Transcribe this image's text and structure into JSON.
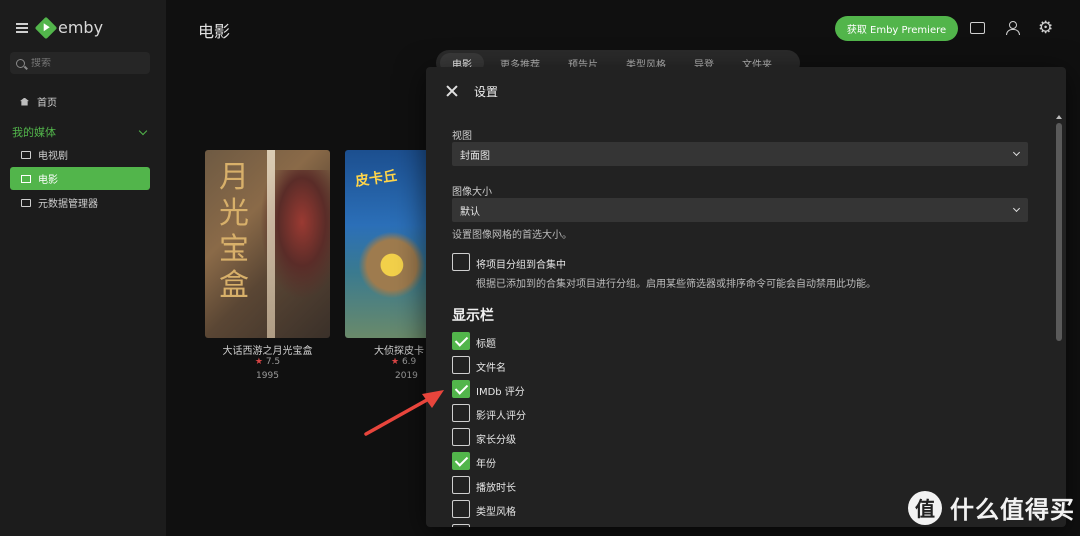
{
  "brand": {
    "name": "emby"
  },
  "sidebar": {
    "search_placeholder": "搜索",
    "home_label": "首页",
    "section_label": "我的媒体",
    "items": [
      {
        "label": "电视剧",
        "icon": "tv-icon",
        "active": false
      },
      {
        "label": "电影",
        "icon": "film-icon",
        "active": true
      },
      {
        "label": "元数据管理器",
        "icon": "folder-icon",
        "active": false
      }
    ]
  },
  "header": {
    "title": "电影",
    "premiere_label": "获取 Emby Premiere",
    "accent": "#52b54b"
  },
  "tabs": [
    "电影",
    "更多推荐",
    "预告片",
    "类型风格",
    "导登",
    "文件夹"
  ],
  "posters": [
    {
      "poster_text": "月光宝盒",
      "title": "大话西游之月光宝盒",
      "rating": "7.5",
      "year": "1995"
    },
    {
      "poster_text": "皮卡丘",
      "title": "大侦探皮卡",
      "rating": "6.9",
      "year": "2019"
    }
  ],
  "dialog": {
    "title": "设置",
    "view_label": "视图",
    "view_value": "封面图",
    "image_size_label": "图像大小",
    "image_size_value": "默认",
    "image_size_help": "设置图像网格的首选大小。",
    "group_label": "将项目分组到合集中",
    "group_desc": "根据已添加到的合集对项目进行分组。启用某些筛选器或排序命令可能会自动禁用此功能。",
    "group_checked": false,
    "columns_title": "显示栏",
    "columns": [
      {
        "label": "标题",
        "checked": true
      },
      {
        "label": "文件名",
        "checked": false
      },
      {
        "label": "IMDb 评分",
        "checked": true
      },
      {
        "label": "影评人评分",
        "checked": false
      },
      {
        "label": "家长分级",
        "checked": false
      },
      {
        "label": "年份",
        "checked": true
      },
      {
        "label": "播放时长",
        "checked": false
      },
      {
        "label": "类型风格",
        "checked": false
      }
    ]
  },
  "watermark": {
    "badge": "值",
    "text": "什么值得买"
  }
}
